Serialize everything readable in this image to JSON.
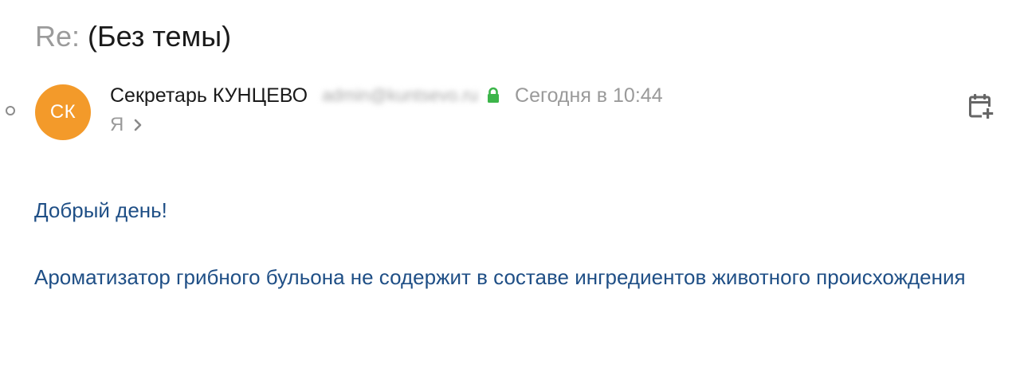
{
  "email": {
    "subject_prefix": "Re:",
    "subject": "(Без темы)",
    "sender": {
      "initials": "СК",
      "name": "Секретарь КУНЦЕВО",
      "email": "admin@kuntsevo.ru",
      "avatar_color": "#f39a2a"
    },
    "date": "Сегодня в 10:44",
    "recipient": "Я",
    "body": {
      "greeting": "Добрый день!",
      "message": "Ароматизатор грибного бульона не содержит в составе ингредиентов животного происхождения"
    }
  },
  "colors": {
    "body_text": "#1f4f86",
    "muted_text": "#9a9a9a",
    "lock": "#3cb54a",
    "icon": "#666666"
  },
  "icons": {
    "status": "circle-outline-icon",
    "secure": "lock-icon",
    "expand": "chevron-right-icon",
    "calendar": "calendar-add-icon"
  }
}
